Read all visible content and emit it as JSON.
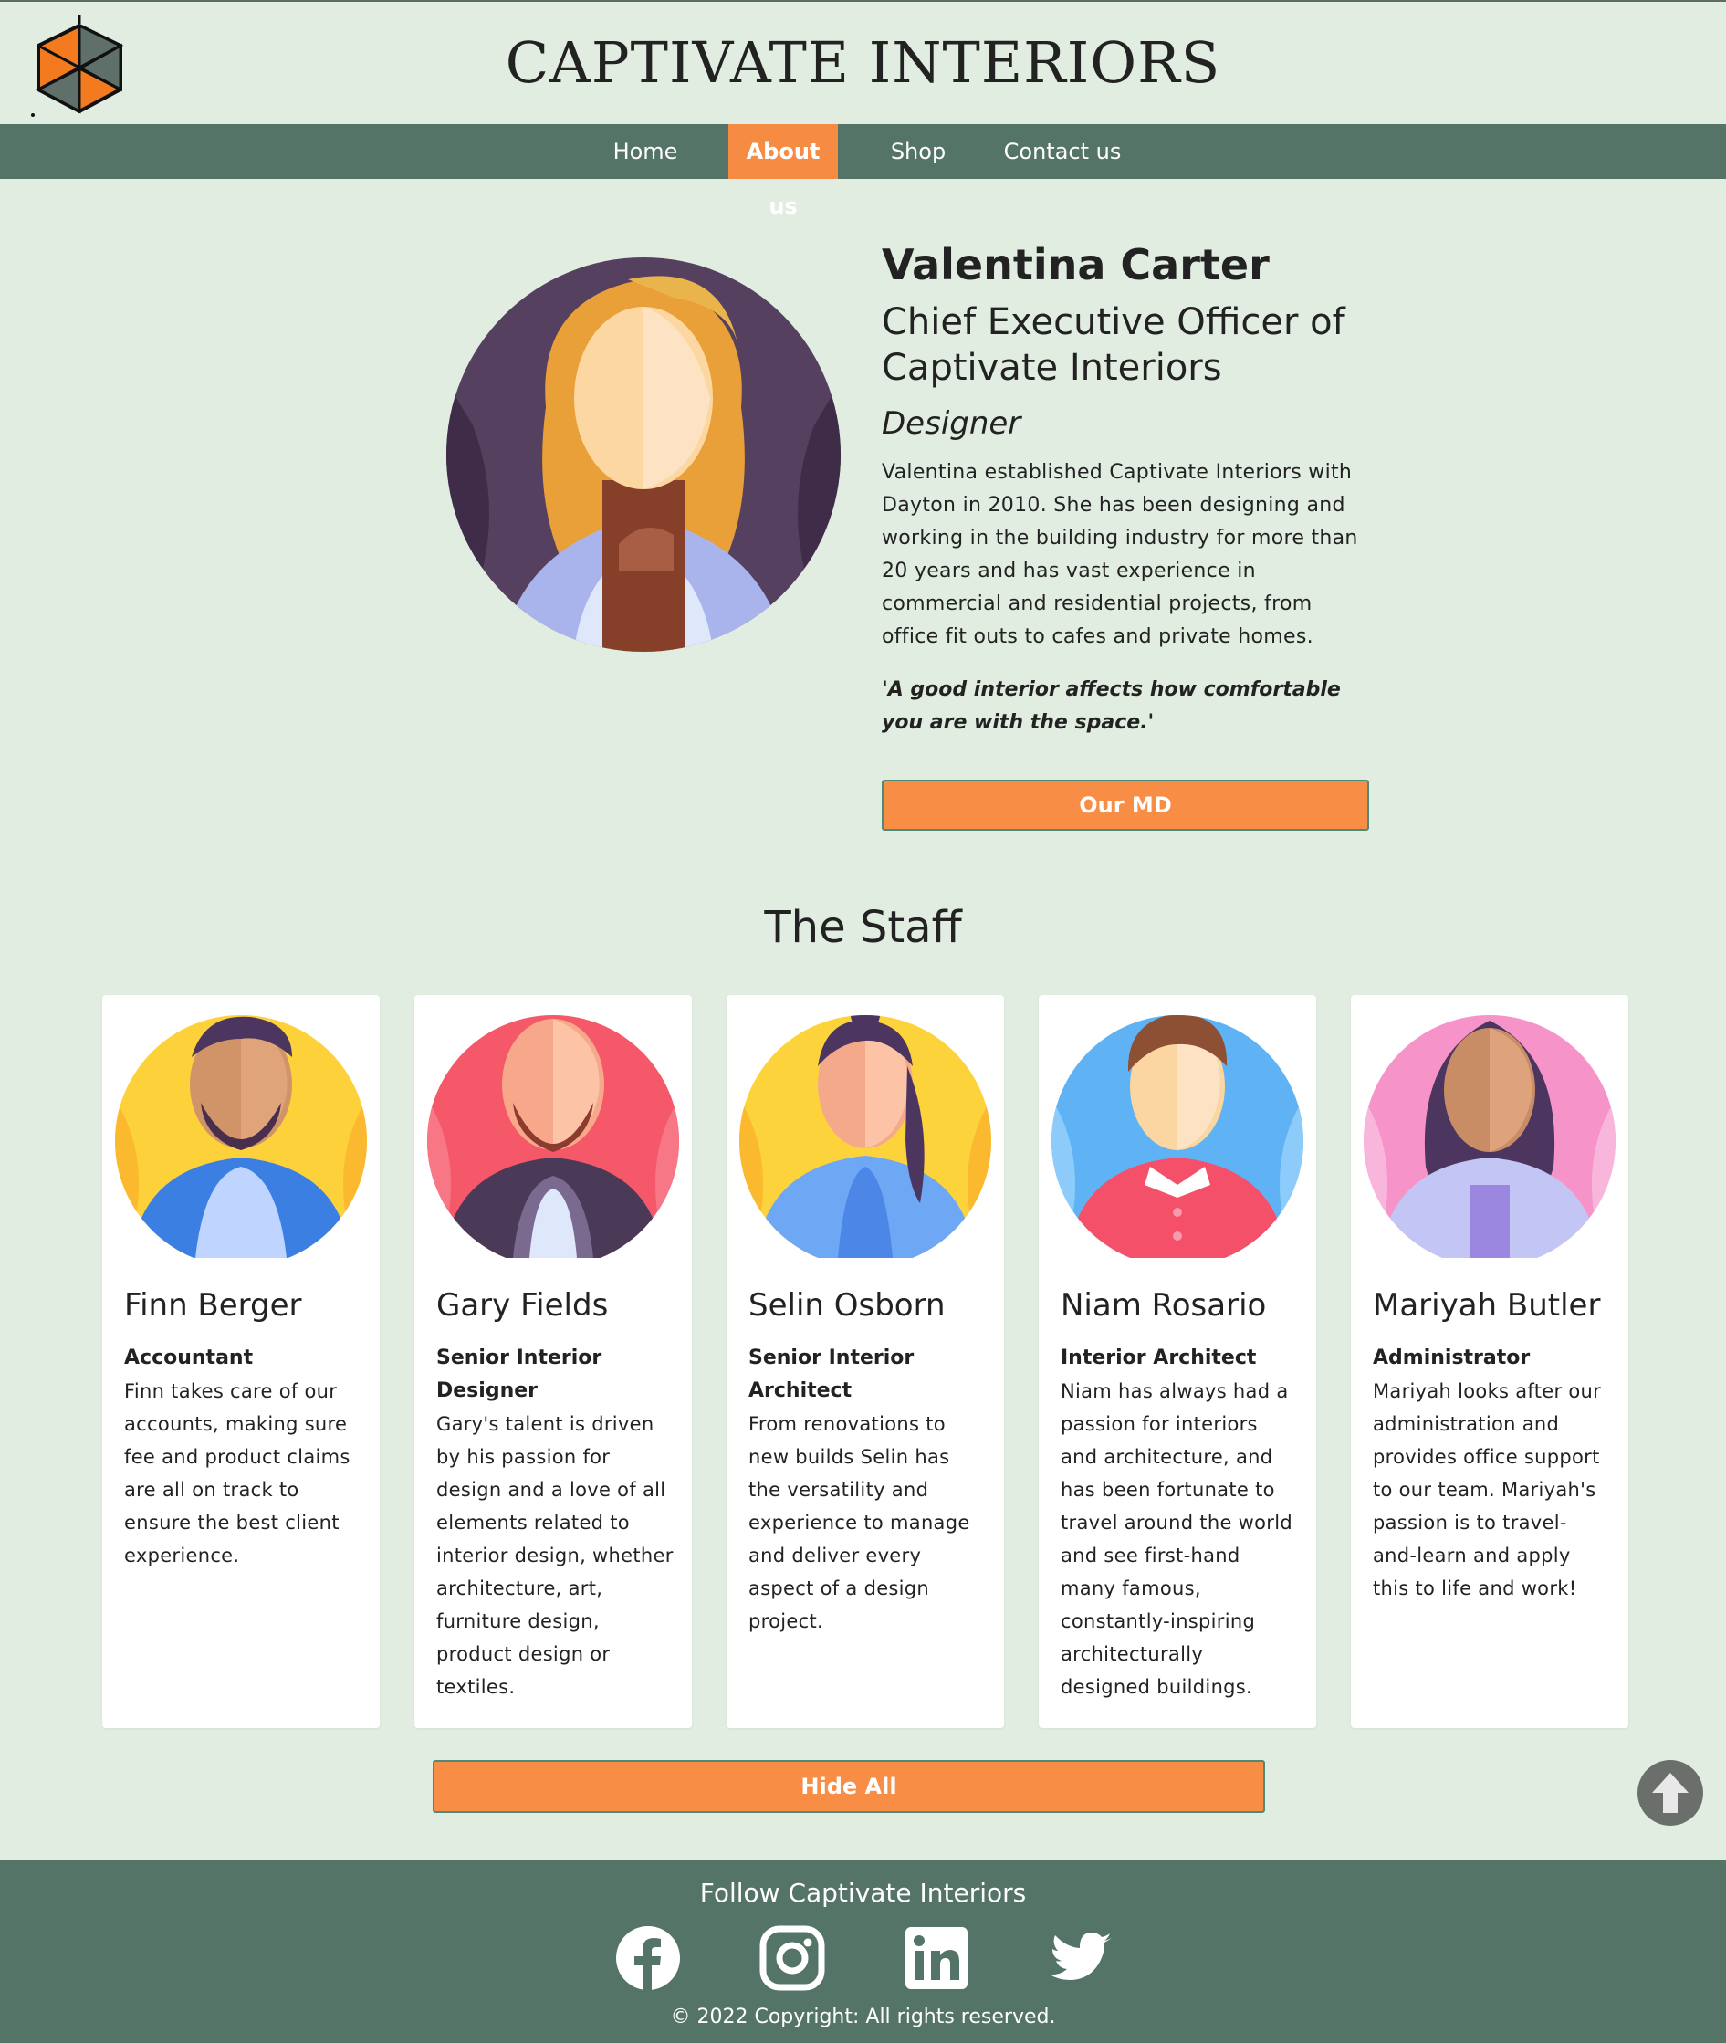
{
  "brand": {
    "name": "CAPTIVATE INTERIORS",
    "logo_icon": "hexagon-logo-icon"
  },
  "nav": [
    {
      "label": "Home",
      "active": false
    },
    {
      "label": "About us",
      "active": true
    },
    {
      "label": "Shop",
      "active": false
    },
    {
      "label": "Contact us",
      "active": false
    }
  ],
  "md": {
    "name": "Valentina Carter",
    "title": "Chief Executive Officer of Captivate Interiors",
    "role": "Designer",
    "bio": "Valentina established Captivate Interiors with Dayton in 2010. She has been designing and working in the building industry for more than 20 years and has vast experience in commercial and residential projects, from office fit outs to cafes and private homes.",
    "quote": "'A good interior affects how comfortable you are with the space.'",
    "button": "Our MD"
  },
  "staff": {
    "heading": "The Staff",
    "members": [
      {
        "name": "Finn Berger",
        "role": "Accountant",
        "desc": "Finn takes care of our accounts, making sure fee and product claims are all on track to ensure the best client experience."
      },
      {
        "name": "Gary Fields",
        "role": "Senior Interior Designer",
        "desc": "Gary's talent is driven by his passion for design and a love of all elements related to interior design, whether architecture, art, furniture design, product design or textiles."
      },
      {
        "name": "Selin Osborn",
        "role": "Senior Interior Architect",
        "desc": "From renovations to new builds Selin has the versatility and experience to manage and deliver every aspect of a design project."
      },
      {
        "name": "Niam Rosario",
        "role": "Interior Architect",
        "desc": "Niam has always had a passion for interiors and architecture, and has been fortunate to travel around the world and see first-hand many famous, constantly-inspiring architecturally designed buildings."
      },
      {
        "name": "Mariyah Butler",
        "role": "Administrator",
        "desc": "Mariyah looks after our administration and provides office support to our team. Mariyah's passion is to travel-and-learn and apply this to life and work!"
      }
    ],
    "button": "Hide All"
  },
  "footer": {
    "follow": "Follow Captivate Interiors",
    "social": [
      "facebook-icon",
      "instagram-icon",
      "linkedin-icon",
      "twitter-icon"
    ],
    "copyright": "© 2022 Copyright: All rights reserved."
  },
  "colors": {
    "accent": "#f88d45",
    "nav_bg": "#557468",
    "page_bg": "#e2ede2"
  }
}
